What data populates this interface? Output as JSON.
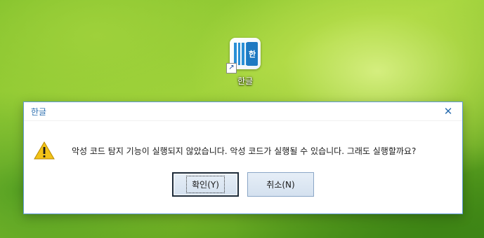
{
  "desktop": {
    "icon_label": "한글",
    "icon_glyph": "한"
  },
  "dialog": {
    "title": "한글",
    "close_symbol": "✕",
    "message": "악성 코드 탐지 기능이 실행되지 않았습니다. 악성 코드가 실행될 수 있습니다. 그래도 실행할까요?",
    "buttons": {
      "ok_label": "확인(Y)",
      "cancel_label": "취소(N)"
    }
  },
  "colors": {
    "accent": "#2d6fb0",
    "dialog_border": "#5f9bd4",
    "warning": "#f2c318"
  }
}
